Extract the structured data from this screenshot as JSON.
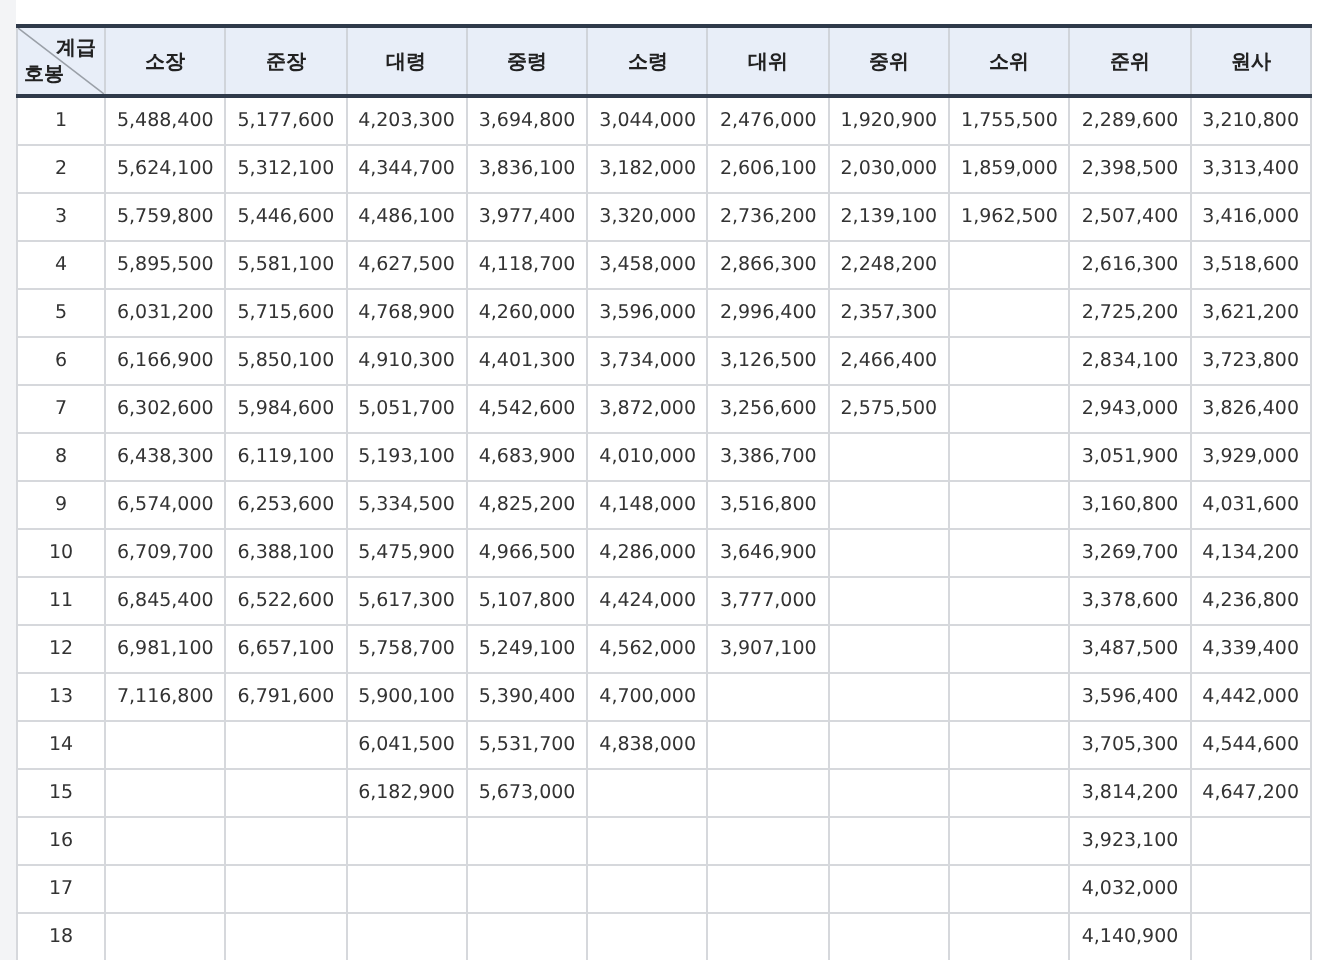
{
  "table": {
    "corner": {
      "top": "계급",
      "bottom": "호봉"
    },
    "columns": [
      "소장",
      "준장",
      "대령",
      "중령",
      "소령",
      "대위",
      "중위",
      "소위",
      "준위",
      "원사"
    ],
    "rows": [
      {
        "step": "1",
        "cells": [
          "5,488,400",
          "5,177,600",
          "4,203,300",
          "3,694,800",
          "3,044,000",
          "2,476,000",
          "1,920,900",
          "1,755,500",
          "2,289,600",
          "3,210,800"
        ]
      },
      {
        "step": "2",
        "cells": [
          "5,624,100",
          "5,312,100",
          "4,344,700",
          "3,836,100",
          "3,182,000",
          "2,606,100",
          "2,030,000",
          "1,859,000",
          "2,398,500",
          "3,313,400"
        ]
      },
      {
        "step": "3",
        "cells": [
          "5,759,800",
          "5,446,600",
          "4,486,100",
          "3,977,400",
          "3,320,000",
          "2,736,200",
          "2,139,100",
          "1,962,500",
          "2,507,400",
          "3,416,000"
        ]
      },
      {
        "step": "4",
        "cells": [
          "5,895,500",
          "5,581,100",
          "4,627,500",
          "4,118,700",
          "3,458,000",
          "2,866,300",
          "2,248,200",
          null,
          "2,616,300",
          "3,518,600"
        ]
      },
      {
        "step": "5",
        "cells": [
          "6,031,200",
          "5,715,600",
          "4,768,900",
          "4,260,000",
          "3,596,000",
          "2,996,400",
          "2,357,300",
          null,
          "2,725,200",
          "3,621,200"
        ]
      },
      {
        "step": "6",
        "cells": [
          "6,166,900",
          "5,850,100",
          "4,910,300",
          "4,401,300",
          "3,734,000",
          "3,126,500",
          "2,466,400",
          null,
          "2,834,100",
          "3,723,800"
        ]
      },
      {
        "step": "7",
        "cells": [
          "6,302,600",
          "5,984,600",
          "5,051,700",
          "4,542,600",
          "3,872,000",
          "3,256,600",
          "2,575,500",
          null,
          "2,943,000",
          "3,826,400"
        ]
      },
      {
        "step": "8",
        "cells": [
          "6,438,300",
          "6,119,100",
          "5,193,100",
          "4,683,900",
          "4,010,000",
          "3,386,700",
          null,
          null,
          "3,051,900",
          "3,929,000"
        ]
      },
      {
        "step": "9",
        "cells": [
          "6,574,000",
          "6,253,600",
          "5,334,500",
          "4,825,200",
          "4,148,000",
          "3,516,800",
          null,
          null,
          "3,160,800",
          "4,031,600"
        ]
      },
      {
        "step": "10",
        "cells": [
          "6,709,700",
          "6,388,100",
          "5,475,900",
          "4,966,500",
          "4,286,000",
          "3,646,900",
          null,
          null,
          "3,269,700",
          "4,134,200"
        ]
      },
      {
        "step": "11",
        "cells": [
          "6,845,400",
          "6,522,600",
          "5,617,300",
          "5,107,800",
          "4,424,000",
          "3,777,000",
          null,
          null,
          "3,378,600",
          "4,236,800"
        ]
      },
      {
        "step": "12",
        "cells": [
          "6,981,100",
          "6,657,100",
          "5,758,700",
          "5,249,100",
          "4,562,000",
          "3,907,100",
          null,
          null,
          "3,487,500",
          "4,339,400"
        ]
      },
      {
        "step": "13",
        "cells": [
          "7,116,800",
          "6,791,600",
          "5,900,100",
          "5,390,400",
          "4,700,000",
          null,
          null,
          null,
          "3,596,400",
          "4,442,000"
        ]
      },
      {
        "step": "14",
        "cells": [
          null,
          null,
          "6,041,500",
          "5,531,700",
          "4,838,000",
          null,
          null,
          null,
          "3,705,300",
          "4,544,600"
        ]
      },
      {
        "step": "15",
        "cells": [
          null,
          null,
          "6,182,900",
          "5,673,000",
          null,
          null,
          null,
          null,
          "3,814,200",
          "4,647,200"
        ]
      },
      {
        "step": "16",
        "cells": [
          null,
          null,
          null,
          null,
          null,
          null,
          null,
          null,
          "3,923,100",
          null
        ]
      },
      {
        "step": "17",
        "cells": [
          null,
          null,
          null,
          null,
          null,
          null,
          null,
          null,
          "4,032,000",
          null
        ]
      },
      {
        "step": "18",
        "cells": [
          null,
          null,
          null,
          null,
          null,
          null,
          null,
          null,
          "4,140,900",
          null
        ]
      }
    ]
  }
}
